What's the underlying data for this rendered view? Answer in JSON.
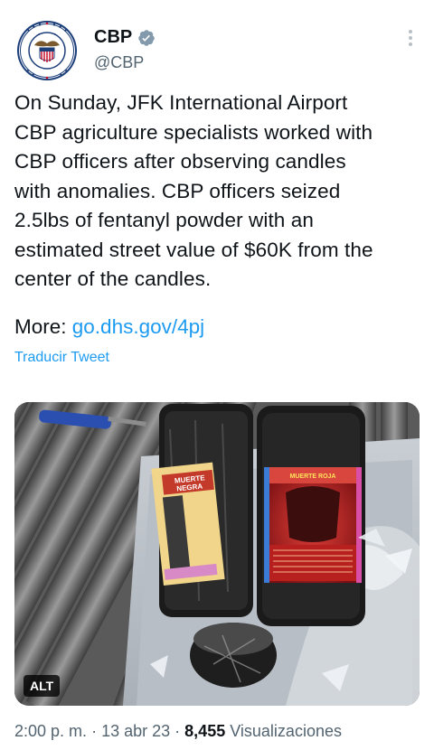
{
  "account": {
    "display_name": "CBP",
    "handle": "@CBP",
    "verified": true
  },
  "tweet": {
    "lines": [
      "On Sunday, JFK International Airport",
      "CBP agriculture specialists worked with",
      "CBP officers after observing candles",
      "with anomalies. CBP officers seized",
      "2.5lbs of fentanyl powder with an",
      "estimated street value of $60K from the",
      "center of the candles."
    ],
    "more_label": "More:",
    "more_link": "go.dhs.gov/4pj",
    "translate_label": "Traducir Tweet"
  },
  "media": {
    "alt_badge": "ALT",
    "jar_left_label_lines": [
      "MUERTE",
      "NEGRA"
    ],
    "jar_right_label": "MUERTE ROJA"
  },
  "footer": {
    "time": "2:00 p. m.",
    "separator": "·",
    "date": "13 abr 23",
    "views_count": "8,455",
    "views_label": "Visualizaciones"
  },
  "colors": {
    "link": "#1d9bf0",
    "secondary_text": "#536471",
    "primary_text": "#0f1419",
    "verified_badge": "#829aab"
  },
  "icons": {
    "verified": "verified-badge-icon",
    "more": "more-options-icon"
  }
}
